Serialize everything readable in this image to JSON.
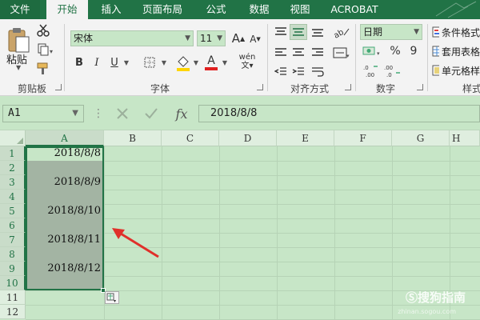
{
  "tabs": [
    "文件",
    "开始",
    "插入",
    "页面布局",
    "公式",
    "数据",
    "视图",
    "ACROBAT"
  ],
  "clipboard": {
    "paste_label": "粘贴",
    "group_label": "剪贴板"
  },
  "font": {
    "name": "宋体",
    "size": "11",
    "group_label": "字体",
    "bold": "B",
    "italic": "I",
    "underline": "U",
    "grow": "A",
    "shrink": "A",
    "font_color_letter": "A",
    "phonetic": "wén"
  },
  "alignment": {
    "group_label": "对齐方式"
  },
  "number": {
    "format": "日期",
    "percent": "%",
    "comma": "9",
    "group_label": "数字"
  },
  "styles": {
    "conditional": "条件格式",
    "table": "套用表格",
    "cell_styles": "单元格样",
    "group_label": "样式"
  },
  "formula_bar": {
    "name_box": "A1",
    "formula": "2018/8/8",
    "fx": "fx"
  },
  "columns": [
    "A",
    "B",
    "C",
    "D",
    "E",
    "F",
    "G",
    "H"
  ],
  "rows": [
    "1",
    "2",
    "3",
    "4",
    "5",
    "6",
    "7",
    "8",
    "9",
    "10",
    "11",
    "12"
  ],
  "cells": [
    "2018/8/8",
    "2018/8/9",
    "2018/8/10",
    "2018/8/11",
    "2018/8/12"
  ],
  "watermark": "搜狗指南",
  "watermark_url": "zhinan.sogou.com",
  "colors": {
    "accent": "#217346",
    "sheet_bg": "#c7e6c7",
    "selection": "#a3b4a3",
    "arrow": "#e0302a"
  }
}
